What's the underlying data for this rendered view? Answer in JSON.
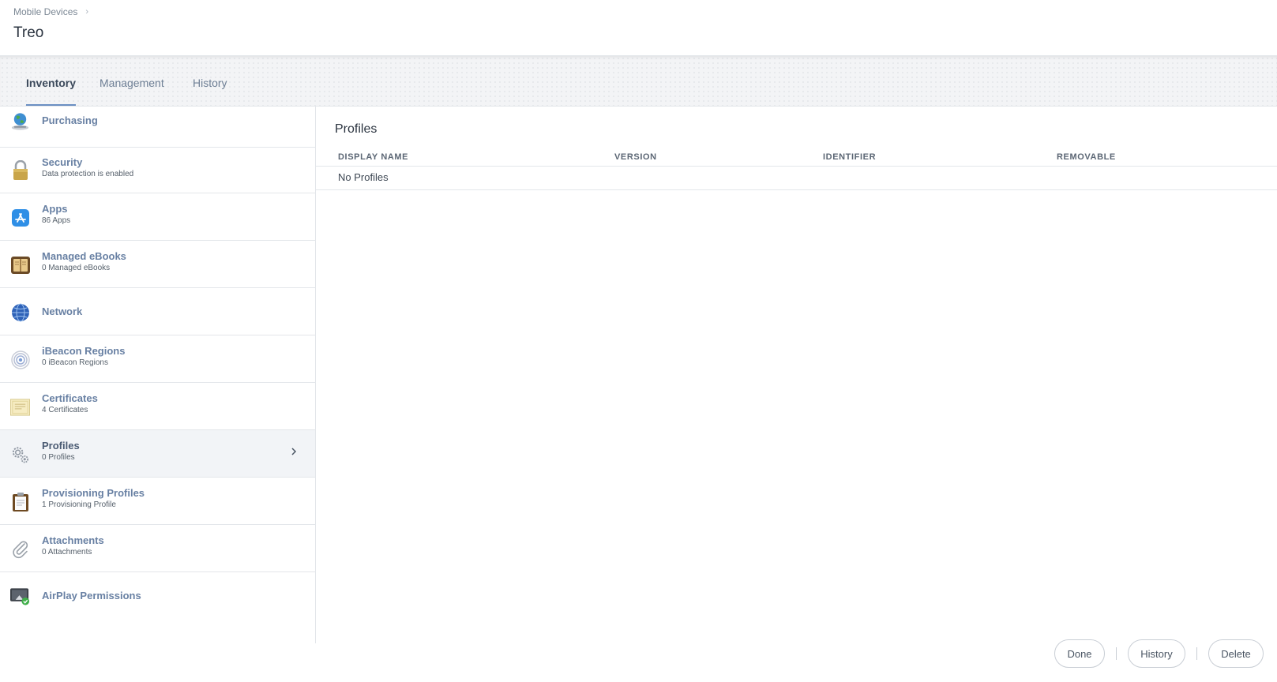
{
  "breadcrumb": {
    "parent": "Mobile Devices",
    "separator": "›"
  },
  "page_title": "Treo",
  "tabs": [
    {
      "label": "Inventory",
      "active": true
    },
    {
      "label": "Management",
      "active": false
    },
    {
      "label": "History",
      "active": false
    }
  ],
  "sidebar": {
    "items": [
      {
        "label": "Purchasing",
        "sub": "",
        "icon": "globe-purchasing-icon"
      },
      {
        "label": "Security",
        "sub": "Data protection is enabled",
        "icon": "lock-icon"
      },
      {
        "label": "Apps",
        "sub": "86 Apps",
        "icon": "app-store-icon"
      },
      {
        "label": "Managed eBooks",
        "sub": "0 Managed eBooks",
        "icon": "book-icon"
      },
      {
        "label": "Network",
        "sub": "",
        "icon": "network-globe-icon"
      },
      {
        "label": "iBeacon Regions",
        "sub": "0 iBeacon Regions",
        "icon": "beacon-icon"
      },
      {
        "label": "Certificates",
        "sub": "4 Certificates",
        "icon": "certificate-icon"
      },
      {
        "label": "Profiles",
        "sub": "0 Profiles",
        "icon": "gears-icon",
        "active": true
      },
      {
        "label": "Provisioning Profiles",
        "sub": "1 Provisioning Profile",
        "icon": "clipboard-icon"
      },
      {
        "label": "Attachments",
        "sub": "0 Attachments",
        "icon": "paperclip-icon"
      },
      {
        "label": "AirPlay Permissions",
        "sub": "",
        "icon": "airplay-icon"
      }
    ]
  },
  "main": {
    "title": "Profiles",
    "columns": [
      "DISPLAY NAME",
      "VERSION",
      "IDENTIFIER",
      "REMOVABLE"
    ],
    "empty_text": "No Profiles"
  },
  "footer": {
    "done": "Done",
    "history": "History",
    "delete": "Delete"
  },
  "colors": {
    "accent": "#6a8fc2",
    "link": "#6880a3",
    "border": "#e3e6ea"
  }
}
